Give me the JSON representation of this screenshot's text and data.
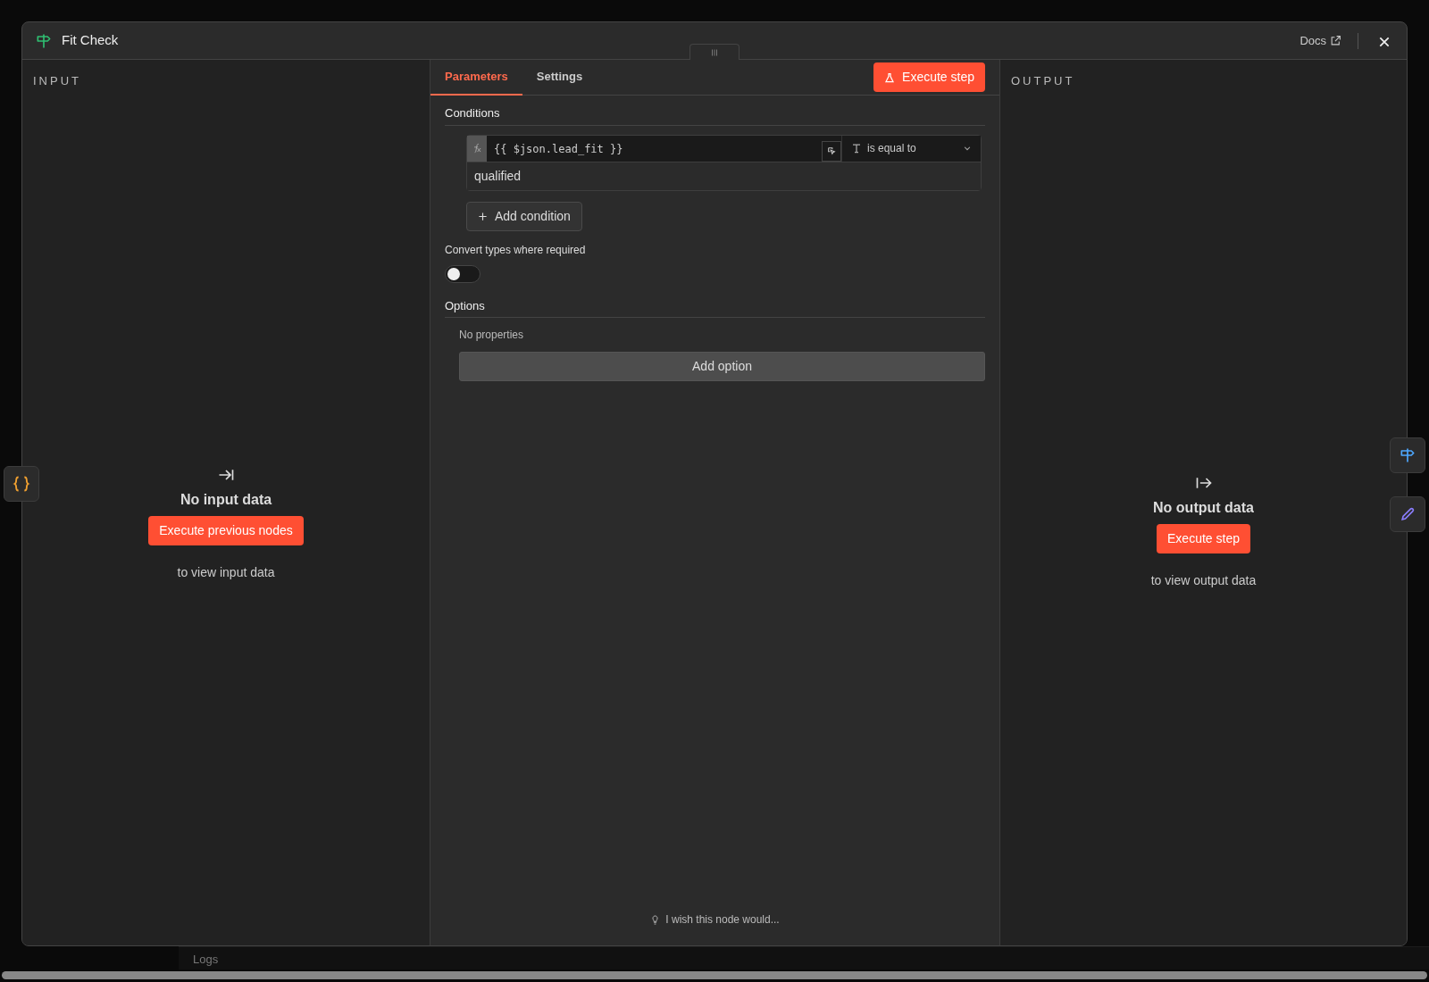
{
  "window": {
    "title": "Fit Check",
    "docs_link": "Docs"
  },
  "background": {
    "logs_label": "Logs"
  },
  "input_panel": {
    "heading": "INPUT",
    "empty_title": "No input data",
    "button": "Execute previous nodes",
    "hint": "to view input data"
  },
  "tabs": [
    {
      "label": "Parameters",
      "selected": true
    },
    {
      "label": "Settings",
      "selected": false
    }
  ],
  "execute_button": "Execute step",
  "conditions": {
    "heading": "Conditions",
    "items": [
      {
        "left_value": "{{ $json.lead_fit }}",
        "operator": "is equal to",
        "right_value": "qualified"
      }
    ],
    "add_button": "Add condition"
  },
  "convert_types": {
    "label": "Convert types where required",
    "on": false
  },
  "options": {
    "heading": "Options",
    "empty_text": "No properties",
    "add_button": "Add option"
  },
  "feedback_link": "I wish this node would...",
  "output_panel": {
    "heading": "OUTPUT",
    "empty_title": "No output data",
    "button": "Execute step",
    "hint": "to view output data"
  }
}
